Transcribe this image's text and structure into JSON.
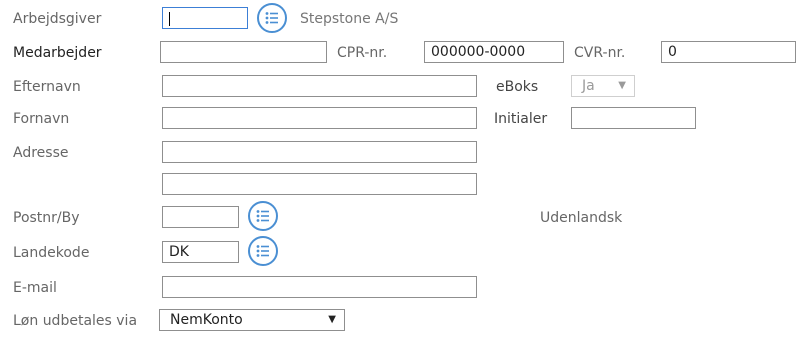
{
  "form": {
    "employer_label": "Arbejdsgiver",
    "employer_name": "Stepstone A/S",
    "employee_label": "Medarbejder",
    "cpr_label": "CPR-nr.",
    "cpr_value": "000000-0000",
    "cvr_label": "CVR-nr.",
    "cvr_value": "0",
    "lastname_label": "Efternavn",
    "eboks_label": "eBoks",
    "eboks_value": "Ja",
    "firstname_label": "Fornavn",
    "initials_label": "Initialer",
    "address_label": "Adresse",
    "postal_label": "Postnr/By",
    "foreign_label": "Udenlandsk",
    "country_label": "Landekode",
    "country_value": "DK",
    "email_label": "E-mail",
    "salary_label": "Løn udbetales via",
    "salary_value": "NemKonto"
  },
  "icons": {
    "lookup": "list-icon",
    "dropdown": "triangle-down-icon"
  },
  "colors": {
    "accent": "#4a8fd3",
    "focus_border": "#3c7fd6"
  }
}
